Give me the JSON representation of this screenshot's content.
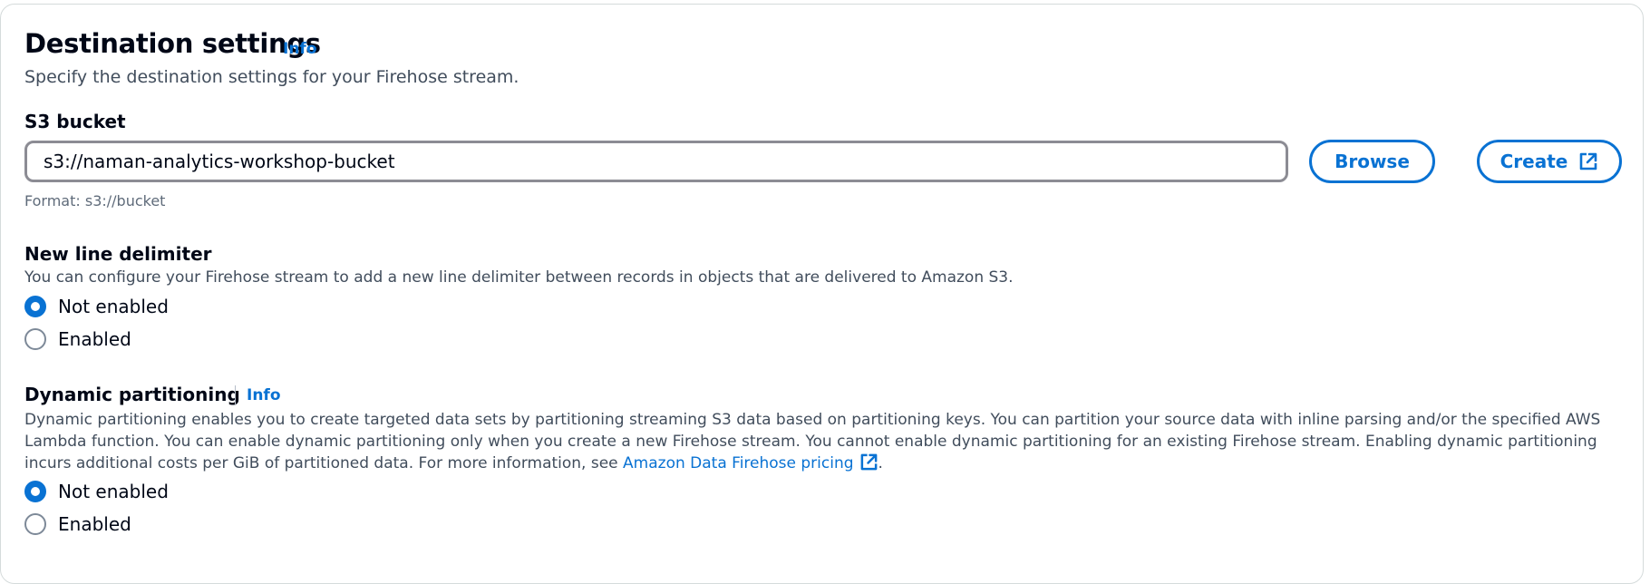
{
  "section": {
    "title": "Destination settings",
    "info_label": "Info",
    "description": "Specify the destination settings for your Firehose stream."
  },
  "s3_bucket": {
    "label": "S3 bucket",
    "value": "s3://naman-analytics-workshop-bucket",
    "hint": "Format: s3://bucket",
    "browse_label": "Browse",
    "create_label": "Create"
  },
  "new_line_delimiter": {
    "label": "New line delimiter",
    "description": "You can configure your Firehose stream to add a new line delimiter between records in objects that are delivered to Amazon S3.",
    "options": [
      {
        "label": "Not enabled",
        "selected": true
      },
      {
        "label": "Enabled",
        "selected": false
      }
    ]
  },
  "dynamic_partitioning": {
    "label": "Dynamic partitioning",
    "info_label": "Info",
    "description": "Dynamic partitioning enables you to create targeted data sets by partitioning streaming S3 data based on partitioning keys. You can partition your source data with inline parsing and/or the specified AWS Lambda function. You can enable dynamic partitioning only when you create a new Firehose stream. You cannot enable dynamic partitioning for an existing Firehose stream. Enabling dynamic partitioning incurs additional costs per GiB of partitioned data. For more information, see ",
    "link_label": "Amazon Data Firehose pricing",
    "description_end": ".",
    "options": [
      {
        "label": "Not enabled",
        "selected": true
      },
      {
        "label": "Enabled",
        "selected": false
      }
    ]
  },
  "icons": {
    "external_link": "external-link-icon"
  },
  "colors": {
    "accent": "#0972d3",
    "text": "#000716",
    "secondary_text": "#414d5c"
  }
}
